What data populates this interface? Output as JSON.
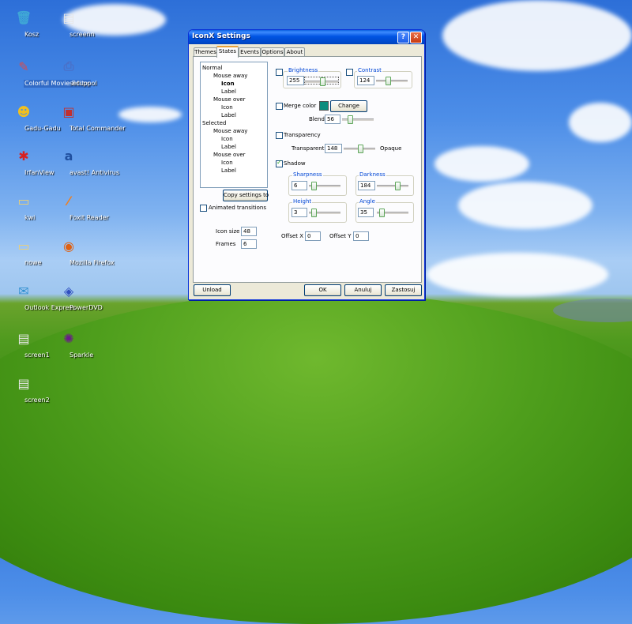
{
  "desktop": {
    "icons": [
      {
        "label": "Kosz",
        "glyph": "🗑",
        "color": "#3fa7d6"
      },
      {
        "label": "screenn",
        "glyph": "▤",
        "color": "#e8e8e8"
      },
      {
        "label": "Colorful Movie Editor",
        "glyph": "✎",
        "color": "#d94d4d"
      },
      {
        "label": "setuppol",
        "glyph": "⎙",
        "color": "#4a70c8"
      },
      {
        "label": "Gadu-Gadu",
        "glyph": "☻",
        "color": "#f0c020"
      },
      {
        "label": "Total Commander",
        "glyph": "▣",
        "color": "#c03030"
      },
      {
        "label": "IrfanView",
        "glyph": "✱",
        "color": "#d82020"
      },
      {
        "label": "avast! Antivirus",
        "glyph": "a",
        "color": "#2050a0"
      },
      {
        "label": "kwi",
        "glyph": "▭",
        "color": "#f0d070"
      },
      {
        "label": "Foxit Reader",
        "glyph": "⁄",
        "color": "#f08020"
      },
      {
        "label": "nowe",
        "glyph": "▭",
        "color": "#f0d070"
      },
      {
        "label": "Mozilla Firefox",
        "glyph": "◉",
        "color": "#e06010"
      },
      {
        "label": "Outlook Express",
        "glyph": "✉",
        "color": "#3090d0"
      },
      {
        "label": "PowerDVD",
        "glyph": "◈",
        "color": "#3050c0"
      },
      {
        "label": "screen1",
        "glyph": "▤",
        "color": "#e8e8e8"
      },
      {
        "label": "Sparkle",
        "glyph": "✺",
        "color": "#6a1a8a"
      },
      {
        "label": "screen2",
        "glyph": "▤",
        "color": "#e8e8e8"
      }
    ]
  },
  "window": {
    "title": "IconX Settings",
    "help_glyph": "?",
    "close_glyph": "✕",
    "tabs": [
      "Themes",
      "States",
      "Events",
      "Options",
      "About"
    ],
    "active_tab": "States",
    "tree": [
      "Normal",
      "Mouse away",
      "Icon",
      "Label",
      "Mouse over",
      "Icon",
      "Label",
      "Selected",
      "Mouse away",
      "Icon",
      "Label",
      "Mouse over",
      "Icon",
      "Label"
    ],
    "copy_settings_label": "Copy settings to",
    "animated_transitions_label": "Animated transitions",
    "icon_size_label": "Icon size",
    "icon_size_value": "48",
    "frames_label": "Frames",
    "frames_value": "6",
    "brightness": {
      "label": "Brightness",
      "value": "255",
      "level": 0.55,
      "checked": false
    },
    "contrast": {
      "label": "Contrast",
      "value": "124",
      "level": 0.35,
      "checked": false
    },
    "merge_color": {
      "label": "Merge color",
      "change_label": "Change",
      "checked": false,
      "color": "#0d8d7e"
    },
    "blend": {
      "label": "Blend",
      "value": "56",
      "level": 0.2
    },
    "transparency": {
      "label": "Transparency",
      "checked": false,
      "left_label": "Transparent",
      "right_label": "Opaque",
      "value": "148",
      "level": 0.55
    },
    "shadow": {
      "label": "Shadow",
      "checked": true
    },
    "sharpness": {
      "label": "Sharpness",
      "value": "6",
      "level": 0.1
    },
    "darkness": {
      "label": "Darkness",
      "value": "184",
      "level": 0.7
    },
    "height": {
      "label": "Height",
      "value": "3",
      "level": 0.1
    },
    "angle": {
      "label": "Angle",
      "value": "35",
      "level": 0.1
    },
    "offset_x": {
      "label": "Offset X",
      "value": "0"
    },
    "offset_y": {
      "label": "Offset Y",
      "value": "0"
    },
    "buttons": {
      "unload": "Unload",
      "ok": "OK",
      "cancel": "Anuluj",
      "apply": "Zastosuj"
    }
  }
}
